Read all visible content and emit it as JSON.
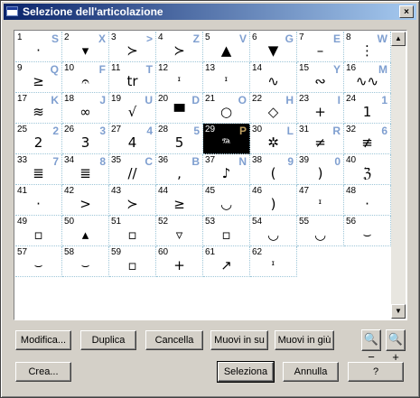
{
  "window": {
    "title": "Selezione dell'articolazione",
    "close_glyph": "×"
  },
  "cells": [
    {
      "n": "1",
      "k": "S",
      "s": "·"
    },
    {
      "n": "2",
      "k": "X",
      "s": "▾"
    },
    {
      "n": "3",
      "k": ">",
      "s": "≻"
    },
    {
      "n": "4",
      "k": "Z",
      "s": "≻"
    },
    {
      "n": "5",
      "k": "V",
      "s": "▲"
    },
    {
      "n": "6",
      "k": "G",
      "s": "▼"
    },
    {
      "n": "7",
      "k": "E",
      "s": "–"
    },
    {
      "n": "8",
      "k": "W",
      "s": "⋮"
    },
    {
      "n": "9",
      "k": "Q",
      "s": "≥"
    },
    {
      "n": "10",
      "k": "F",
      "s": "𝄐"
    },
    {
      "n": "11",
      "k": "T",
      "s": "tr"
    },
    {
      "n": "12",
      "k": "",
      "s": "ᶦ"
    },
    {
      "n": "13",
      "k": "",
      "s": "ᶦ"
    },
    {
      "n": "14",
      "k": "",
      "s": "∿"
    },
    {
      "n": "15",
      "k": "Y",
      "s": "∾"
    },
    {
      "n": "16",
      "k": "M",
      "s": "∿∿"
    },
    {
      "n": "17",
      "k": "K",
      "s": "≋"
    },
    {
      "n": "18",
      "k": "J",
      "s": "∞"
    },
    {
      "n": "19",
      "k": "U",
      "s": "√"
    },
    {
      "n": "20",
      "k": "D",
      "s": "▀"
    },
    {
      "n": "21",
      "k": "O",
      "s": "○"
    },
    {
      "n": "22",
      "k": "H",
      "s": "◇"
    },
    {
      "n": "23",
      "k": "I",
      "s": "+"
    },
    {
      "n": "24",
      "k": "1",
      "s": "1"
    },
    {
      "n": "25",
      "k": "2",
      "s": "2"
    },
    {
      "n": "26",
      "k": "3",
      "s": "3"
    },
    {
      "n": "27",
      "k": "4",
      "s": "4"
    },
    {
      "n": "28",
      "k": "5",
      "s": "5"
    },
    {
      "n": "29",
      "k": "P",
      "s": "𝆮"
    },
    {
      "n": "30",
      "k": "L",
      "s": "✲"
    },
    {
      "n": "31",
      "k": "R",
      "s": "≠"
    },
    {
      "n": "32",
      "k": "6",
      "s": "≢"
    },
    {
      "n": "33",
      "k": "7",
      "s": "≣"
    },
    {
      "n": "34",
      "k": "8",
      "s": "≣"
    },
    {
      "n": "35",
      "k": "C",
      "s": "//"
    },
    {
      "n": "36",
      "k": "B",
      "s": ","
    },
    {
      "n": "37",
      "k": "N",
      "s": "♪"
    },
    {
      "n": "38",
      "k": "9",
      "s": "("
    },
    {
      "n": "39",
      "k": "0",
      "s": ")"
    },
    {
      "n": "40",
      "k": "",
      "s": "ℨ"
    },
    {
      "n": "41",
      "k": "",
      "s": "·"
    },
    {
      "n": "42",
      "k": "",
      "s": ">"
    },
    {
      "n": "43",
      "k": "",
      "s": "≻"
    },
    {
      "n": "44",
      "k": "",
      "s": "≥"
    },
    {
      "n": "45",
      "k": "",
      "s": "◡"
    },
    {
      "n": "46",
      "k": "",
      "s": ")"
    },
    {
      "n": "47",
      "k": "",
      "s": "ᶦ"
    },
    {
      "n": "48",
      "k": "",
      "s": "·"
    },
    {
      "n": "49",
      "k": "",
      "s": "▫"
    },
    {
      "n": "50",
      "k": "",
      "s": "▴"
    },
    {
      "n": "51",
      "k": "",
      "s": "▫"
    },
    {
      "n": "52",
      "k": "",
      "s": "▿"
    },
    {
      "n": "53",
      "k": "",
      "s": "▫"
    },
    {
      "n": "54",
      "k": "",
      "s": "◡"
    },
    {
      "n": "55",
      "k": "",
      "s": "◡"
    },
    {
      "n": "56",
      "k": "",
      "s": "⌣"
    },
    {
      "n": "57",
      "k": "",
      "s": "⌣"
    },
    {
      "n": "58",
      "k": "",
      "s": "⌣"
    },
    {
      "n": "59",
      "k": "",
      "s": "▫"
    },
    {
      "n": "60",
      "k": "",
      "s": "+"
    },
    {
      "n": "61",
      "k": "",
      "s": "↗"
    },
    {
      "n": "62",
      "k": "",
      "s": "ᶦ"
    }
  ],
  "selected_cell": "29",
  "scrollbar": {
    "up_glyph": "▲",
    "down_glyph": "▼"
  },
  "buttons": {
    "modifica": "Modifica...",
    "duplica": "Duplica",
    "cancella": "Cancella",
    "muovi_su": "Muovi in su",
    "muovi_giu": "Muovi in giù",
    "zoom_out": "🔍−",
    "zoom_in": "🔍+",
    "crea": "Crea...",
    "seleziona": "Seleziona",
    "annulla": "Annulla",
    "help": "?"
  }
}
